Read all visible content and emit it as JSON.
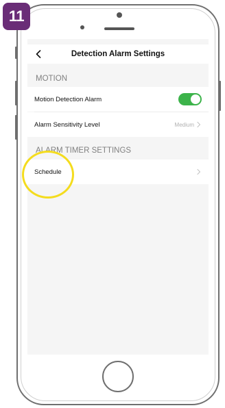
{
  "step_badge": {
    "number": "11",
    "color": "#6a2d77"
  },
  "nav": {
    "back_icon": "chevron-left-icon",
    "title": "Detection Alarm Settings"
  },
  "sections": {
    "motion": {
      "header": "MOTION",
      "rows": {
        "motion_detection": {
          "label": "Motion Detection Alarm",
          "toggle_on": true,
          "toggle_color": "#3cb34a"
        },
        "sensitivity": {
          "label": "Alarm Sensitivity Level",
          "value": "Medium"
        }
      }
    },
    "timer": {
      "header": "ALARM TIMER SETTINGS",
      "rows": {
        "schedule": {
          "label": "Schedule"
        }
      }
    }
  },
  "highlight_color": "#f4dc1e"
}
